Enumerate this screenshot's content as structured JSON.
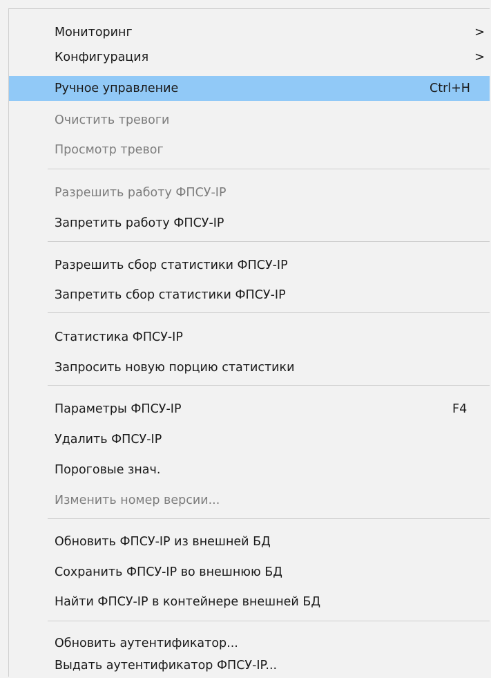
{
  "menu": {
    "items": [
      {
        "label": "Мониторинг",
        "submenu_arrow": ">"
      },
      {
        "label": "Конфигурация",
        "submenu_arrow": ">"
      },
      {
        "label": "Ручное управление",
        "shortcut": "Ctrl+H",
        "highlighted": true
      },
      {
        "label": "Очистить тревоги",
        "disabled": true
      },
      {
        "label": "Просмотр тревог",
        "disabled": true
      },
      {
        "label": "Разрешить работу ФПСУ-IP",
        "disabled": true
      },
      {
        "label": "Запретить работу ФПСУ-IP"
      },
      {
        "label": "Разрешить сбор статистики ФПСУ-IP"
      },
      {
        "label": "Запретить сбор статистики ФПСУ-IP"
      },
      {
        "label": "Статистика ФПСУ-IP"
      },
      {
        "label": "Запросить новую порцию статистики"
      },
      {
        "label": "Параметры ФПСУ-IP",
        "shortcut": "F4"
      },
      {
        "label": "Удалить ФПСУ-IP"
      },
      {
        "label": "Пороговые знач."
      },
      {
        "label": "Изменить номер версии...",
        "disabled": true
      },
      {
        "label": "Обновить ФПСУ-IP из внешней БД"
      },
      {
        "label": "Сохранить ФПСУ-IP во внешнюю БД"
      },
      {
        "label": "Найти ФПСУ-IP в контейнере внешней БД"
      },
      {
        "label": "Обновить аутентификатор..."
      },
      {
        "label": "Выдать аутентификатор ФПСУ-IP..."
      }
    ],
    "colors": {
      "highlight": "#91c9f7",
      "text": "#1a1a1a",
      "disabled_text": "#7d7d7d",
      "background": "#f2f2f2",
      "separator": "#cdcdcd"
    }
  }
}
